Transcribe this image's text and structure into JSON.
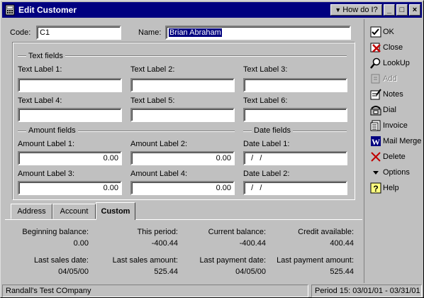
{
  "window": {
    "title": "Edit Customer",
    "how_do_i": "How do I?",
    "min": "_",
    "max": "□",
    "close": "×"
  },
  "header": {
    "code_label": "Code:",
    "code_value": "C1",
    "name_label": "Name:",
    "name_value": "Brian Abraham"
  },
  "text_fields": {
    "section": "Text fields",
    "labels": [
      "Text Label 1:",
      "Text Label 2:",
      "Text Label 3:",
      "Text Label 4:",
      "Text Label 5:",
      "Text Label 6:"
    ]
  },
  "amount_fields": {
    "section": "Amount fields",
    "labels": [
      "Amount Label 1:",
      "Amount Label 2:",
      "Amount Label 3:",
      "Amount Label 4:"
    ],
    "values": [
      "0.00",
      "0.00",
      "0.00",
      "0.00"
    ]
  },
  "date_fields": {
    "section": "Date fields",
    "labels": [
      "Date Label 1:",
      "Date Label 2:"
    ],
    "values": [
      "  /   /",
      "  /   /"
    ]
  },
  "tabs": [
    {
      "label": "Address",
      "active": false
    },
    {
      "label": "Account",
      "active": false
    },
    {
      "label": "Custom",
      "active": true
    }
  ],
  "summary": {
    "beginning_balance_label": "Beginning balance:",
    "beginning_balance": "0.00",
    "this_period_label": "This period:",
    "this_period": "-400.44",
    "current_balance_label": "Current balance:",
    "current_balance": "-400.44",
    "credit_available_label": "Credit available:",
    "credit_available": "400.44",
    "last_sales_date_label": "Last sales date:",
    "last_sales_date": "04/05/00",
    "last_sales_amount_label": "Last sales amount:",
    "last_sales_amount": "525.44",
    "last_payment_date_label": "Last payment date:",
    "last_payment_date": "04/05/00",
    "last_payment_amount_label": "Last payment amount:",
    "last_payment_amount": "525.44"
  },
  "sidebar": {
    "items": [
      {
        "label": "OK",
        "icon": "checkmark-icon"
      },
      {
        "label": "Close",
        "icon": "close-icon"
      },
      {
        "label": "LookUp",
        "icon": "magnifier-icon"
      },
      {
        "label": "Add",
        "icon": "add-icon",
        "disabled": true
      },
      {
        "label": "Notes",
        "icon": "notes-icon"
      },
      {
        "label": "Dial",
        "icon": "phone-icon"
      },
      {
        "label": "Invoice",
        "icon": "invoice-icon"
      },
      {
        "label": "Mail Merge",
        "icon": "word-icon"
      },
      {
        "label": "Delete",
        "icon": "delete-icon"
      },
      {
        "label": "Options",
        "icon": "triangle-down-icon"
      },
      {
        "label": "Help",
        "icon": "help-icon"
      }
    ]
  },
  "status": {
    "company": "Randall's Test COmpany",
    "period": "Period 15: 03/01/01 - 03/31/01"
  }
}
